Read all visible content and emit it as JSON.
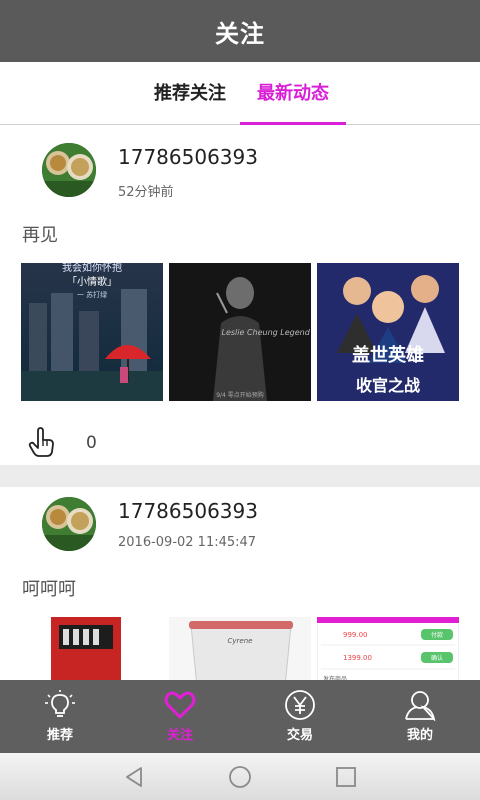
{
  "header": {
    "title": "关注"
  },
  "tabs": [
    {
      "label": "推荐关注",
      "active": false
    },
    {
      "label": "最新动态",
      "active": true
    }
  ],
  "accent_color": "#d91fd7",
  "posts": [
    {
      "username": "17786506393",
      "time": "52分钟前",
      "content": "再见",
      "images": [
        {
          "caption_top": "我会如你怀抱",
          "caption_mid": "「小情歌」",
          "caption_sub": "一 苏打绿"
        },
        {
          "caption": "Leslie Cheung Legend Continues",
          "caption_sub": "9/4 零点开始预购"
        },
        {
          "caption_top": "盖世英雄",
          "caption_bottom": "收官之战"
        }
      ],
      "like_icon": "hand-pointer-icon",
      "likes": "0"
    },
    {
      "username": "17786506393",
      "time": "2016-09-02 11:45:47",
      "content": "呵呵呵",
      "images": [
        {
          "type": "red-vending-machine"
        },
        {
          "type": "cooking-pot",
          "brand": "Cyrene"
        },
        {
          "price1": "999.00",
          "price2": "1399.00",
          "btn1": "付款",
          "btn2": "确认",
          "footer": "发布商品"
        }
      ]
    }
  ],
  "bottom_nav": [
    {
      "label": "推荐",
      "icon": "lightbulb-icon",
      "active": false
    },
    {
      "label": "关注",
      "icon": "heart-icon",
      "active": true
    },
    {
      "label": "交易",
      "icon": "yen-icon",
      "active": false
    },
    {
      "label": "我的",
      "icon": "user-icon",
      "active": false
    }
  ],
  "system_nav": {
    "back_icon": "back-triangle-icon",
    "home_icon": "home-circle-icon",
    "recent_icon": "recents-square-icon"
  }
}
